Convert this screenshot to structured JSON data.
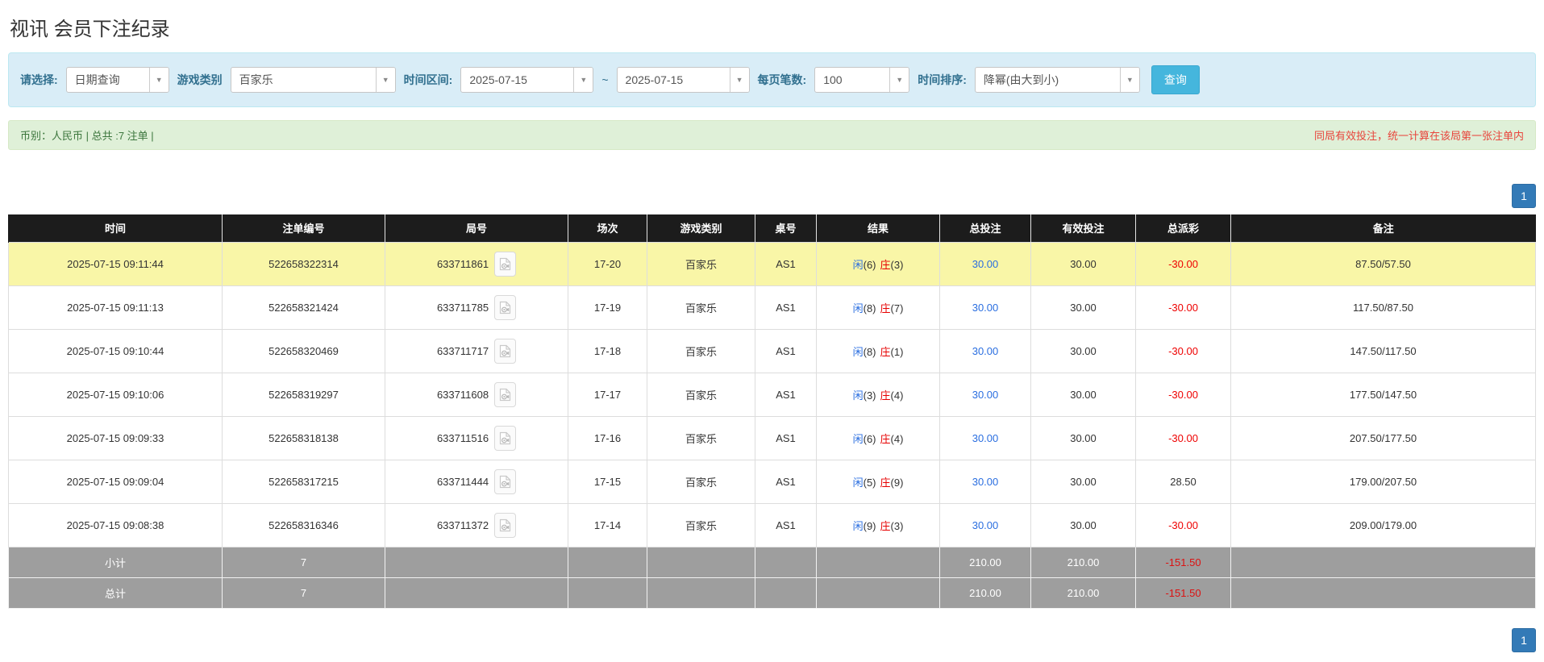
{
  "page": {
    "title": "视讯 会员下注纪录"
  },
  "colors": {
    "accent_cyan": "#45b6dd",
    "panel_blue_bg": "#d9edf7",
    "panel_label_blue": "#31708f",
    "success_bg": "#dff0d8",
    "success_text": "#3c763d",
    "warning_red": "#e8453c",
    "highlight_yellow": "#f9f6a7",
    "header_bg": "#1c1c1c",
    "summary_gray": "#9e9e9e",
    "link_blue": "#2a6ee0",
    "negative_red": "#ee0000",
    "pager_blue": "#337ab7"
  },
  "filters": {
    "query_type": {
      "label": "请选择:",
      "value": "日期查询"
    },
    "game_type": {
      "label": "游戏类别",
      "value": "百家乐"
    },
    "time_range": {
      "label": "时间区间:",
      "from": "2025-07-15",
      "separator": "~",
      "to": "2025-07-15"
    },
    "page_size": {
      "label": "每页笔数:",
      "value": "100"
    },
    "time_sort": {
      "label": "时间排序:",
      "value": "降幂(由大到小)"
    },
    "search_button": "查询"
  },
  "summary_bar": {
    "left": "币别：人民币 | 总共 :7 注单 |",
    "right": "同局有效投注，统一计算在该局第一张注单内"
  },
  "pagination": {
    "page": "1"
  },
  "table": {
    "columns": [
      "时间",
      "注单编号",
      "局号",
      "场次",
      "游戏类别",
      "桌号",
      "结果",
      "总投注",
      "有效投注",
      "总派彩",
      "备注"
    ],
    "rows": [
      {
        "time": "2025-07-15 09:11:44",
        "bet_id": "522658322314",
        "round": "633711861",
        "session": "17-20",
        "game": "百家乐",
        "table_no": "AS1",
        "result": {
          "player": "闲",
          "player_pts": "(6)",
          "banker": "庄",
          "banker_pts": "(3)"
        },
        "total_bet": "30.00",
        "valid_bet": "30.00",
        "payout": "-30.00",
        "remark": "87.50/57.50",
        "highlight": true
      },
      {
        "time": "2025-07-15 09:11:13",
        "bet_id": "522658321424",
        "round": "633711785",
        "session": "17-19",
        "game": "百家乐",
        "table_no": "AS1",
        "result": {
          "player": "闲",
          "player_pts": "(8)",
          "banker": "庄",
          "banker_pts": "(7)"
        },
        "total_bet": "30.00",
        "valid_bet": "30.00",
        "payout": "-30.00",
        "remark": "117.50/87.50",
        "highlight": false
      },
      {
        "time": "2025-07-15 09:10:44",
        "bet_id": "522658320469",
        "round": "633711717",
        "session": "17-18",
        "game": "百家乐",
        "table_no": "AS1",
        "result": {
          "player": "闲",
          "player_pts": "(8)",
          "banker": "庄",
          "banker_pts": "(1)"
        },
        "total_bet": "30.00",
        "valid_bet": "30.00",
        "payout": "-30.00",
        "remark": "147.50/117.50",
        "highlight": false
      },
      {
        "time": "2025-07-15 09:10:06",
        "bet_id": "522658319297",
        "round": "633711608",
        "session": "17-17",
        "game": "百家乐",
        "table_no": "AS1",
        "result": {
          "player": "闲",
          "player_pts": "(3)",
          "banker": "庄",
          "banker_pts": "(4)"
        },
        "total_bet": "30.00",
        "valid_bet": "30.00",
        "payout": "-30.00",
        "remark": "177.50/147.50",
        "highlight": false
      },
      {
        "time": "2025-07-15 09:09:33",
        "bet_id": "522658318138",
        "round": "633711516",
        "session": "17-16",
        "game": "百家乐",
        "table_no": "AS1",
        "result": {
          "player": "闲",
          "player_pts": "(6)",
          "banker": "庄",
          "banker_pts": "(4)"
        },
        "total_bet": "30.00",
        "valid_bet": "30.00",
        "payout": "-30.00",
        "remark": "207.50/177.50",
        "highlight": false
      },
      {
        "time": "2025-07-15 09:09:04",
        "bet_id": "522658317215",
        "round": "633711444",
        "session": "17-15",
        "game": "百家乐",
        "table_no": "AS1",
        "result": {
          "player": "闲",
          "player_pts": "(5)",
          "banker": "庄",
          "banker_pts": "(9)"
        },
        "total_bet": "30.00",
        "valid_bet": "30.00",
        "payout": "28.50",
        "remark": "179.00/207.50",
        "highlight": false
      },
      {
        "time": "2025-07-15 09:08:38",
        "bet_id": "522658316346",
        "round": "633711372",
        "session": "17-14",
        "game": "百家乐",
        "table_no": "AS1",
        "result": {
          "player": "闲",
          "player_pts": "(9)",
          "banker": "庄",
          "banker_pts": "(3)"
        },
        "total_bet": "30.00",
        "valid_bet": "30.00",
        "payout": "-30.00",
        "remark": "209.00/179.00",
        "highlight": false
      }
    ],
    "subtotal": {
      "label": "小计",
      "count": "7",
      "total_bet": "210.00",
      "valid_bet": "210.00",
      "payout": "-151.50"
    },
    "total": {
      "label": "总计",
      "count": "7",
      "total_bet": "210.00",
      "valid_bet": "210.00",
      "payout": "-151.50"
    }
  }
}
